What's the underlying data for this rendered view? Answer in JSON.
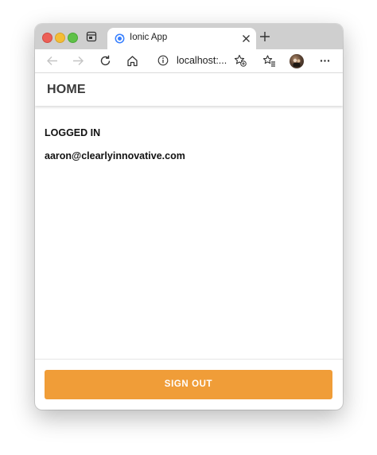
{
  "browser": {
    "tab": {
      "title": "Ionic App",
      "favicon": "ionic-icon"
    },
    "toolbar": {
      "address": "localhost:...",
      "icons": [
        "back-icon",
        "forward-icon",
        "reload-icon",
        "home-icon",
        "info-icon",
        "add-favorite-icon",
        "favorites-icon",
        "profile-avatar",
        "more-icon"
      ]
    },
    "colors": {
      "tabstrip": "#cfcfcf",
      "close_button": "#ec5f56",
      "minimize_button": "#f4bd36",
      "zoom_button": "#5fc148"
    }
  },
  "app": {
    "header": {
      "title": "HOME"
    },
    "content": {
      "status": "LOGGED IN",
      "email": "aaron@clearlyinnovative.com"
    },
    "footer": {
      "signout_label": "SIGN OUT"
    },
    "colors": {
      "accent": "#f09d38"
    }
  }
}
